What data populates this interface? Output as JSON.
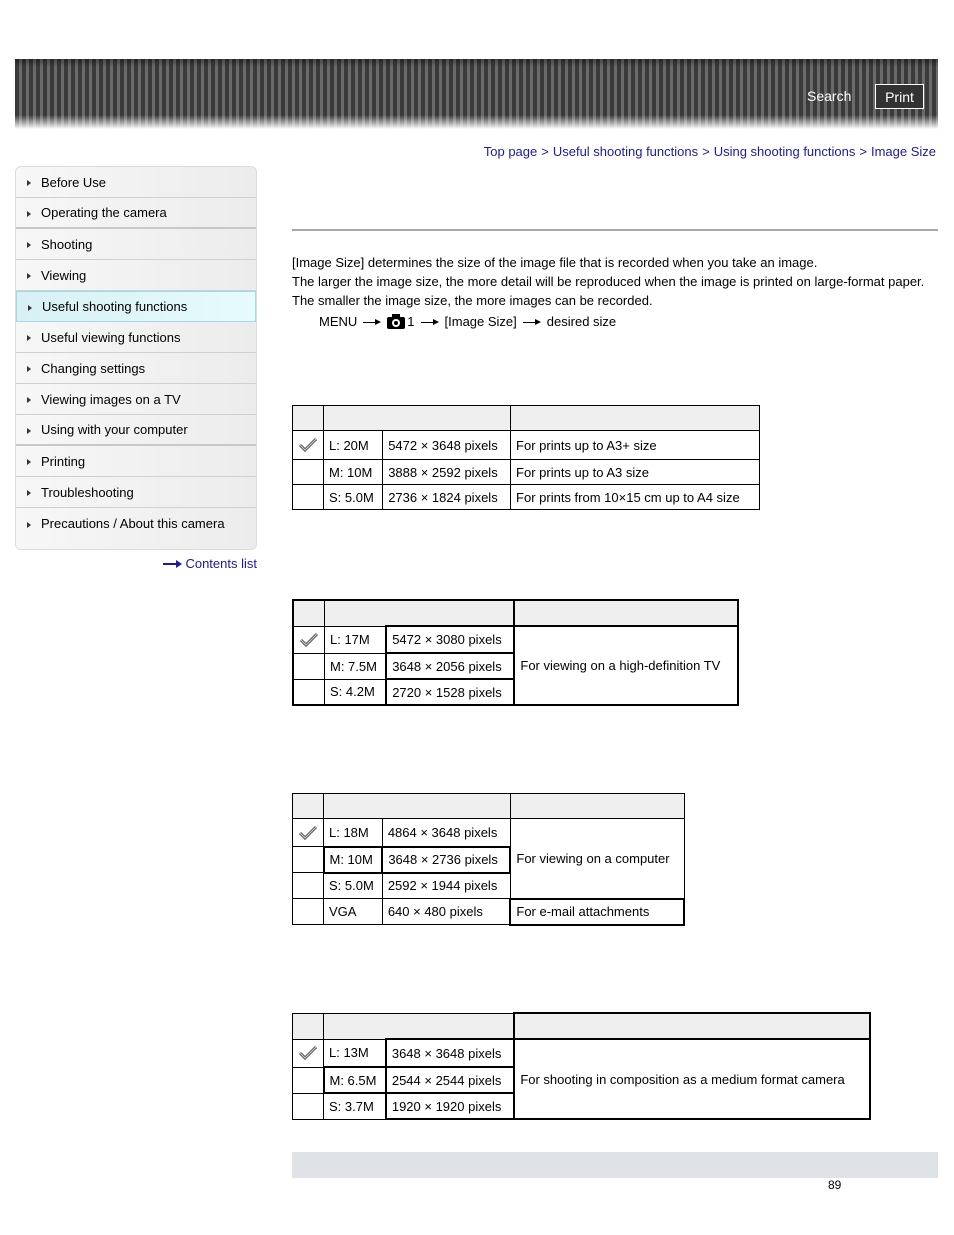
{
  "header": {
    "search_label": "Search",
    "print_label": "Print"
  },
  "breadcrumb": {
    "items": [
      "Top page",
      "Useful shooting functions",
      "Using shooting functions",
      "Image Size"
    ],
    "separator": ">"
  },
  "sidebar": {
    "items": [
      {
        "label": "Before Use"
      },
      {
        "label": "Operating the camera"
      },
      {
        "label": "Shooting"
      },
      {
        "label": "Viewing"
      },
      {
        "label": "Useful shooting functions",
        "active": true
      },
      {
        "label": "Useful viewing functions"
      },
      {
        "label": "Changing settings"
      },
      {
        "label": "Viewing images on a TV"
      },
      {
        "label": "Using with your computer"
      },
      {
        "label": "Printing"
      },
      {
        "label": "Troubleshooting"
      },
      {
        "label": "Precautions / About this camera"
      }
    ],
    "contents_link": "Contents list"
  },
  "intro": {
    "line1": "[Image Size] determines the size of the image file that is recorded when you take an image.",
    "line2": "The larger the image size, the more detail will be reproduced when the image is printed on large-format paper. The smaller the image size, the more images can be recorded."
  },
  "menu_path": {
    "menu": "MENU",
    "tab_number": "1",
    "item": "[Image Size]",
    "end": "desired size"
  },
  "tables": [
    {
      "rows": [
        {
          "checked": true,
          "size": "L: 20M",
          "pixels": "5472 × 3648 pixels",
          "usage": "For prints up to A3+ size"
        },
        {
          "checked": false,
          "size": "M: 10M",
          "pixels": "3888 × 2592 pixels",
          "usage": "For prints up to A3 size"
        },
        {
          "checked": false,
          "size": "S: 5.0M",
          "pixels": "2736 × 1824 pixels",
          "usage": "For prints from 10×15 cm up to A4 size"
        }
      ]
    },
    {
      "rows": [
        {
          "checked": true,
          "size": "L: 17M",
          "pixels": "5472 × 3080 pixels"
        },
        {
          "checked": false,
          "size": "M: 7.5M",
          "pixels": "3648 × 2056 pixels"
        },
        {
          "checked": false,
          "size": "S: 4.2M",
          "pixels": "2720 × 1528 pixels"
        }
      ],
      "usage": "For viewing on a high-definition TV"
    },
    {
      "rows": [
        {
          "checked": true,
          "size": "L: 18M",
          "pixels": "4864 × 3648 pixels"
        },
        {
          "checked": false,
          "size": "M: 10M",
          "pixels": "3648 × 2736 pixels"
        },
        {
          "checked": false,
          "size": "S: 5.0M",
          "pixels": "2592 × 1944 pixels"
        },
        {
          "checked": false,
          "size": "VGA",
          "pixels": "640 × 480 pixels"
        }
      ],
      "usage_group": "For viewing on a computer",
      "usage_vga": "For e-mail attachments"
    },
    {
      "rows": [
        {
          "checked": true,
          "size": "L: 13M",
          "pixels": "3648 × 3648 pixels"
        },
        {
          "checked": false,
          "size": "M: 6.5M",
          "pixels": "2544 × 2544 pixels"
        },
        {
          "checked": false,
          "size": "S: 3.7M",
          "pixels": "1920 × 1920 pixels"
        }
      ],
      "usage": "For shooting in composition as a medium format camera"
    }
  ],
  "footer": {
    "page_number": "89"
  }
}
